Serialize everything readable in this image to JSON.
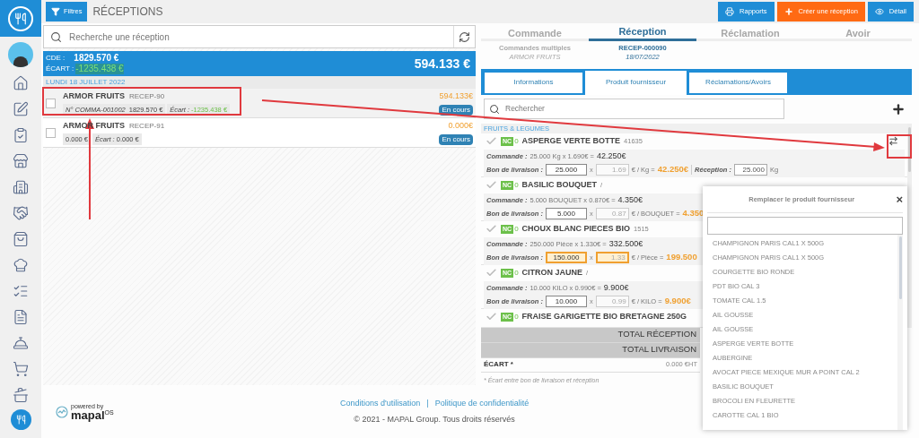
{
  "header": {
    "filter_button": "Filtres",
    "title": "RÉCEPTIONS",
    "buttons": [
      {
        "label": "Rapports",
        "kind": "report"
      },
      {
        "label": "Créer une réception",
        "kind": "create"
      },
      {
        "label": "Détail",
        "kind": "detail"
      }
    ]
  },
  "list": {
    "search_placeholder": "Recherche une réception",
    "summary": {
      "cde_label": "CDE :",
      "cde_value": "1829.570 €",
      "ecart_label": "ÉCART :",
      "ecart_value": "-1235.438 €",
      "total": "594.133 €"
    },
    "date": "LUNDI 18 JUILLET 2022",
    "items": [
      {
        "supplier": "ARMOR FRUITS",
        "ref": "RECEP-90",
        "order_no": "N° COMMA-001002",
        "amount": "1829.570 €",
        "ecart_label": "Écart :",
        "ecart_value": "-1235.438 €",
        "ecart_highlight": true,
        "total": "594.133€",
        "status": "En cours",
        "checked": false,
        "selected": true
      },
      {
        "supplier": "ARMOR FRUITS",
        "ref": "RECEP-91",
        "amount": "0.000 €",
        "ecart_label": "Écart :",
        "ecart_value": "0.000 €",
        "ecart_highlight": false,
        "total": "0.000€",
        "status": "En cours",
        "checked": false,
        "selected": false
      }
    ]
  },
  "detail": {
    "steps": [
      {
        "label": "Commande",
        "selected": false,
        "line1": "Commandes multiples",
        "line2": "ARMOR FRUITS"
      },
      {
        "label": "Réception",
        "selected": true,
        "line1": "RECEP-000090",
        "line2": "18/07/2022"
      },
      {
        "label": "Réclamation",
        "selected": false
      },
      {
        "label": "Avoir",
        "selected": false
      }
    ],
    "tabs": [
      {
        "label": "Informations",
        "selected": false
      },
      {
        "label": "Produit fournisseur",
        "selected": true
      },
      {
        "label": "Réclamations/Avoirs",
        "selected": false
      }
    ],
    "search_placeholder": "Rechercher",
    "category": "FRUITS & LEGUMES",
    "products": [
      {
        "name": "ASPERGE VERTE BOTTE",
        "code": "41635",
        "nc": "NC",
        "nc_count": "0",
        "order_label": "Commande :",
        "order_calc": "25.000 Kg x  1.690€ =",
        "order_total": "42.250€",
        "delivery_label": "Bon de livraison :",
        "delivery_qty": "25.000",
        "times": "x",
        "price": "1.69",
        "unit": "€ / Kg =",
        "delivery_total": "42.250€",
        "reception_label": "Réception :",
        "reception_qty": "25.000",
        "reception_unit": "Kg",
        "warning": false
      },
      {
        "name": "BASILIC BOUQUET",
        "code": "/",
        "nc": "NC",
        "nc_count": "0",
        "order_label": "Commande :",
        "order_calc": "5.000 BOUQUET x  0.870€ =",
        "order_total": "4.350€",
        "delivery_label": "Bon de livraison :",
        "delivery_qty": "5.000",
        "times": "x",
        "price": "0.87",
        "unit": "€ / BOUQUET =",
        "delivery_total": "4.350",
        "warning": false
      },
      {
        "name": "CHOUX BLANC PIECES BIO",
        "code": "1515",
        "nc": "NC",
        "nc_count": "0",
        "order_label": "Commande :",
        "order_calc": "250.000 Pièce x  1.330€ =",
        "order_total": "332.500€",
        "delivery_label": "Bon de livraison :",
        "delivery_qty": "150.000",
        "times": "x",
        "price": "1.33",
        "unit": "€ / Pièce =",
        "delivery_total": "199.500",
        "warning": true
      },
      {
        "name": "CITRON JAUNE",
        "code": "/",
        "nc": "NC",
        "nc_count": "0",
        "order_label": "Commande :",
        "order_calc": "10.000 KILO x  0.990€ =",
        "order_total": "9.900€",
        "delivery_label": "Bon de livraison :",
        "delivery_qty": "10.000",
        "times": "x",
        "price": "0.99",
        "unit": "€ / KILO =",
        "delivery_total": "9.900€",
        "warning": false
      },
      {
        "name": "FRAISE GARIGETTE BIO BRETAGNE 250G",
        "nc": "NC",
        "nc_count": "0"
      }
    ],
    "totals": [
      {
        "label": "TOTAL RÉCEPTION"
      },
      {
        "label": "TOTAL LIVRAISON"
      }
    ],
    "ecart_label": "ÉCART *",
    "ecart_value": "0.000 €HT",
    "footnote": "* Écart entre bon de livraison et réception"
  },
  "popup": {
    "title": "Remplacer le produit fournisseur",
    "close": "×",
    "options": [
      "CHAMPIGNON PARIS CAL1 X 500G",
      "CHAMPIGNON PARIS CAL1 X 500G",
      "COURGETTE BIO RONDE",
      "PDT BIO CAL 3",
      "TOMATE CAL 1.5",
      "AIL GOUSSE",
      "AIL GOUSSE",
      "ASPERGE VERTE BOTTE",
      "AUBERGINE",
      "AVOCAT PIECE MEXIQUE MUR A POINT CAL 2",
      "BASILIC BOUQUET",
      "BROCOLI EN FLEURETTE",
      "CAROTTE CAL 1 BIO"
    ]
  },
  "footer": {
    "powered_by": "powered by",
    "brand": "mapal",
    "brand_suffix": "OS",
    "links": [
      "Conditions d'utilisation",
      "Politique de confidentialité"
    ],
    "separator": "|",
    "copyright": "© 2021 - MAPAL Group. Tous droits réservés"
  }
}
